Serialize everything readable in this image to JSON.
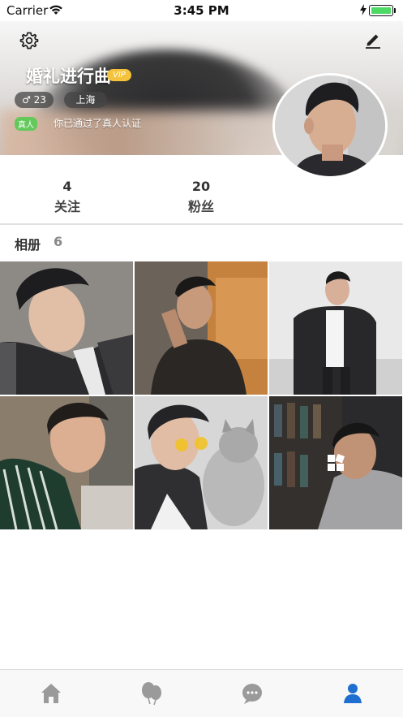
{
  "status_bar": {
    "carrier": "Carrier",
    "time": "3:45 PM",
    "battery_level": 1.0
  },
  "profile": {
    "name": "婚礼进行曲",
    "vip_badge": "VIP",
    "age": "♂ 23",
    "city": "上海",
    "real_badge": "真人",
    "verify_text": "你已通过了真人认证"
  },
  "stats": {
    "following_count": "4",
    "following_label": "关注",
    "fans_count": "20",
    "fans_label": "粉丝"
  },
  "album": {
    "title": "相册",
    "count": "6"
  },
  "icons": {
    "settings": "gear-icon",
    "edit": "pencil-icon",
    "tab_home": "home-icon",
    "tab_discover": "balloons-icon",
    "tab_messages": "chat-bubble-icon",
    "tab_profile": "user-icon"
  },
  "colors": {
    "vip": "#f5c33b",
    "real_badge": "#63c95b",
    "tab_active": "#1f6fd1",
    "tab_inactive": "#9a9a9a"
  }
}
